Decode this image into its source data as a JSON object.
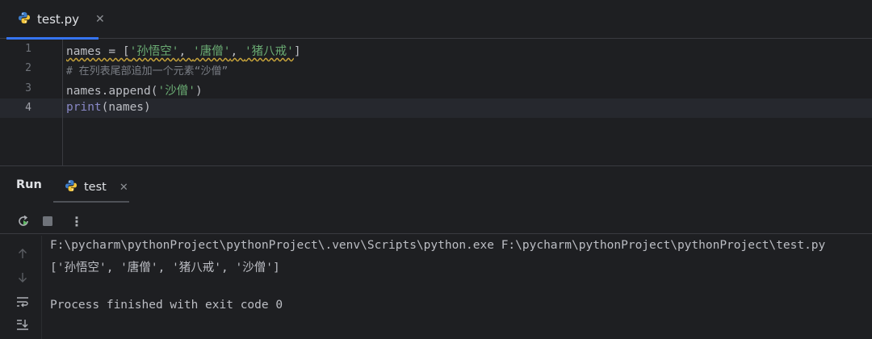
{
  "editor_tab": {
    "filename": "test.py",
    "close": "✕"
  },
  "editor": {
    "line_numbers": [
      "1",
      "2",
      "3",
      "4"
    ],
    "line1": {
      "ident": "names = [",
      "s1": "'孙悟空'",
      "c1": ", ",
      "s2": "'唐僧'",
      "c2": ", ",
      "s3": "'猪八戒'",
      "end": "]"
    },
    "line2": {
      "comment": "# 在列表尾部追加一个元素“沙僧”"
    },
    "line3": {
      "pre": "names.append(",
      "str": "'沙僧'",
      "post": ")"
    },
    "line4": {
      "fn": "print",
      "rest": "(names)"
    }
  },
  "run_panel": {
    "title": "Run",
    "tab_label": "test",
    "tab_close": "✕",
    "toolbar": {
      "rerun_icon": "rerun-icon",
      "stop_icon": "stop-icon",
      "more_label": "⋮"
    },
    "side_icons": [
      "arrow-up-icon",
      "arrow-down-icon",
      "soft-wrap-icon",
      "scroll-to-end-icon"
    ],
    "console": {
      "line1": "F:\\pycharm\\pythonProject\\pythonProject\\.venv\\Scripts\\python.exe F:\\pycharm\\pythonProject\\pythonProject\\test.py",
      "line2": "['孙悟空', '唐僧', '猪八戒', '沙僧']",
      "line3": "Process finished with exit code 0"
    }
  },
  "colors": {
    "accent": "#3574f0",
    "string": "#6aab73",
    "comment": "#7a7e85",
    "builtin": "#8888c6",
    "background": "#1e1f22"
  }
}
